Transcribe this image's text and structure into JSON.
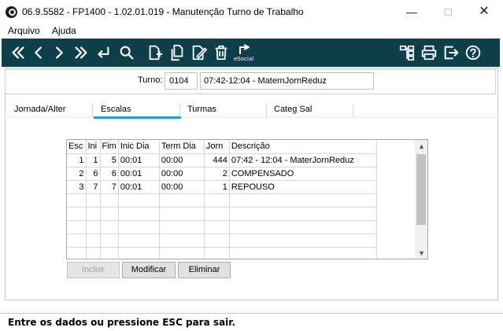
{
  "window": {
    "title": "06.9.5582 - FP1400 - 1.02.01.019 - Manutenção Turno de Trabalho",
    "minimize": "—",
    "close": "✕"
  },
  "menu": {
    "items": [
      "Arquivo",
      "Ajuda"
    ]
  },
  "toolbar": {
    "buttons": [
      "first-icon",
      "previous-icon",
      "next-icon",
      "last-icon",
      "return-icon",
      "search-icon",
      "new-record-icon",
      "copy-icon",
      "edit-icon",
      "delete-icon",
      "esocial-icon",
      "structure-icon",
      "print-icon",
      "exit-icon",
      "help-icon"
    ],
    "esocial_label": "eSocial"
  },
  "turno": {
    "label": "Turno:",
    "code": "0104",
    "description": "07:42-12:04 - MaternJornReduz"
  },
  "tabs": [
    "Jornada/Alter",
    "Escalas",
    "Turmas",
    "Categ Sal"
  ],
  "active_tab": "Escalas",
  "grid": {
    "columns": [
      "Esc",
      "Ini",
      "Fim",
      "Inic Dia",
      "Term Dia",
      "Jorn",
      "Descrição"
    ],
    "rows": [
      [
        "1",
        "1",
        "5",
        "00:01",
        "00:00",
        "444",
        "07:42 - 12:04 - MaterJornReduz"
      ],
      [
        "2",
        "6",
        "6",
        "00:01",
        "00:00",
        "2",
        "COMPENSADO"
      ],
      [
        "3",
        "7",
        "7",
        "00:01",
        "00:00",
        "1",
        "REPOUSO"
      ]
    ]
  },
  "actions": {
    "include": "Incluir",
    "modify": "Modificar",
    "delete": "Eliminar"
  },
  "status": "Entre os dados ou pressione ESC para sair.",
  "colors": {
    "toolbar": "#0f3f4b",
    "tab_underline": "#1f9fd8"
  }
}
